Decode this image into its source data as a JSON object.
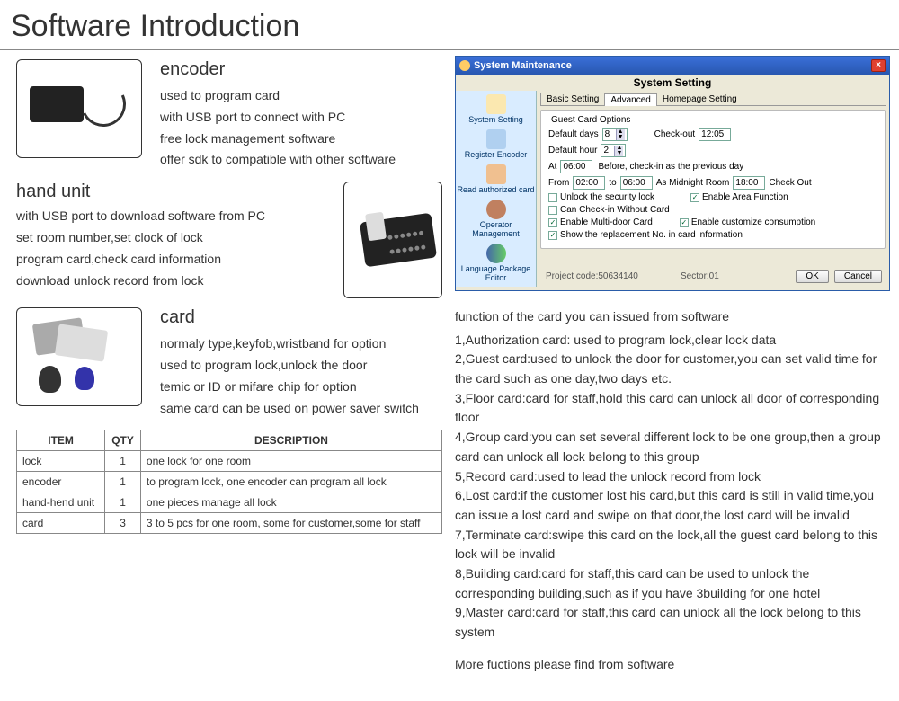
{
  "title": "Software Introduction",
  "encoder": {
    "heading": "encoder",
    "lines": [
      "used to program card",
      "with USB port to connect with PC",
      "free lock management software",
      "offer sdk to compatible with other software"
    ]
  },
  "hand": {
    "heading": "hand unit",
    "lines": [
      "with USB port to download software from PC",
      "set room number,set clock of lock",
      "program card,check card information",
      "download unlock record from lock"
    ]
  },
  "card": {
    "heading": "card",
    "lines": [
      "normaly type,keyfob,wristband for option",
      "used to program lock,unlock the door",
      "temic or ID or mifare chip for option",
      "same card can be used on power saver switch"
    ]
  },
  "table": {
    "headers": [
      "ITEM",
      "QTY",
      "DESCRIPTION"
    ],
    "rows": [
      [
        "lock",
        "1",
        "one lock for one room"
      ],
      [
        "encoder",
        "1",
        "to program lock, one encoder can program all lock"
      ],
      [
        "hand-hend unit",
        "1",
        "one pieces manage all lock"
      ],
      [
        "card",
        "3",
        "3 to 5 pcs for one room, some for customer,some for staff"
      ]
    ]
  },
  "syswin": {
    "title": "System Maintenance",
    "heading": "System Setting",
    "sidebar": [
      "System Setting",
      "Register Encoder",
      "Read authorized card",
      "Operator Management",
      "Language Package Editor"
    ],
    "tabs": [
      "Basic Setting",
      "Advanced",
      "Homepage Setting"
    ],
    "group_title": "Guest Card Options",
    "labels": {
      "default_days": "Default days",
      "default_days_val": "8",
      "checkout": "Check-out",
      "checkout_val": "12:05",
      "default_hour": "Default hour",
      "default_hour_val": "2",
      "at": "At",
      "at_val": "06:00",
      "at_note": "Before, check-in as the previous day",
      "from": "From",
      "from_val": "02:00",
      "to": "to",
      "to_val": "06:00",
      "midroom": "As Midnight Room",
      "midroom_val": "18:00",
      "co2": "Check Out",
      "unlocksec": "Unlock the security lock",
      "areafn": "Enable Area Function",
      "nocheckin": "Can Check-in Without Card",
      "multidoor": "Enable Multi-door Card",
      "custom": "Enable customize consumption",
      "showno": "Show the replacement No. in card information"
    },
    "project": "Project code:50634140",
    "sector": "Sector:01",
    "ok": "OK",
    "cancel": "Cancel"
  },
  "functions": {
    "heading": "function of the card you can issued from software",
    "items": [
      "1,Authorization card: used to program lock,clear lock data",
      "2,Guest card:used to unlock the door for customer,you can set valid time for the card such as one day,two days etc.",
      "3,Floor card:card for staff,hold this card can unlock all door of corresponding floor",
      "4,Group card:you can set several different lock to be one group,then a group card can unlock all lock belong to this group",
      "5,Record card:used to lead the unlock record from lock",
      "6,Lost card:if the customer lost his card,but this card is still in valid time,you can issue a lost card and swipe on that door,the lost card will be invalid",
      "7,Terminate card:swipe this card on the lock,all the guest card belong to this lock will be invalid",
      "8,Building card:card for staff,this card can be used to unlock the corresponding building,such as if you have 3building for one hotel",
      "9,Master card:card for staff,this card can unlock all the lock belong to this system"
    ],
    "more": "More fuctions please find from software"
  }
}
